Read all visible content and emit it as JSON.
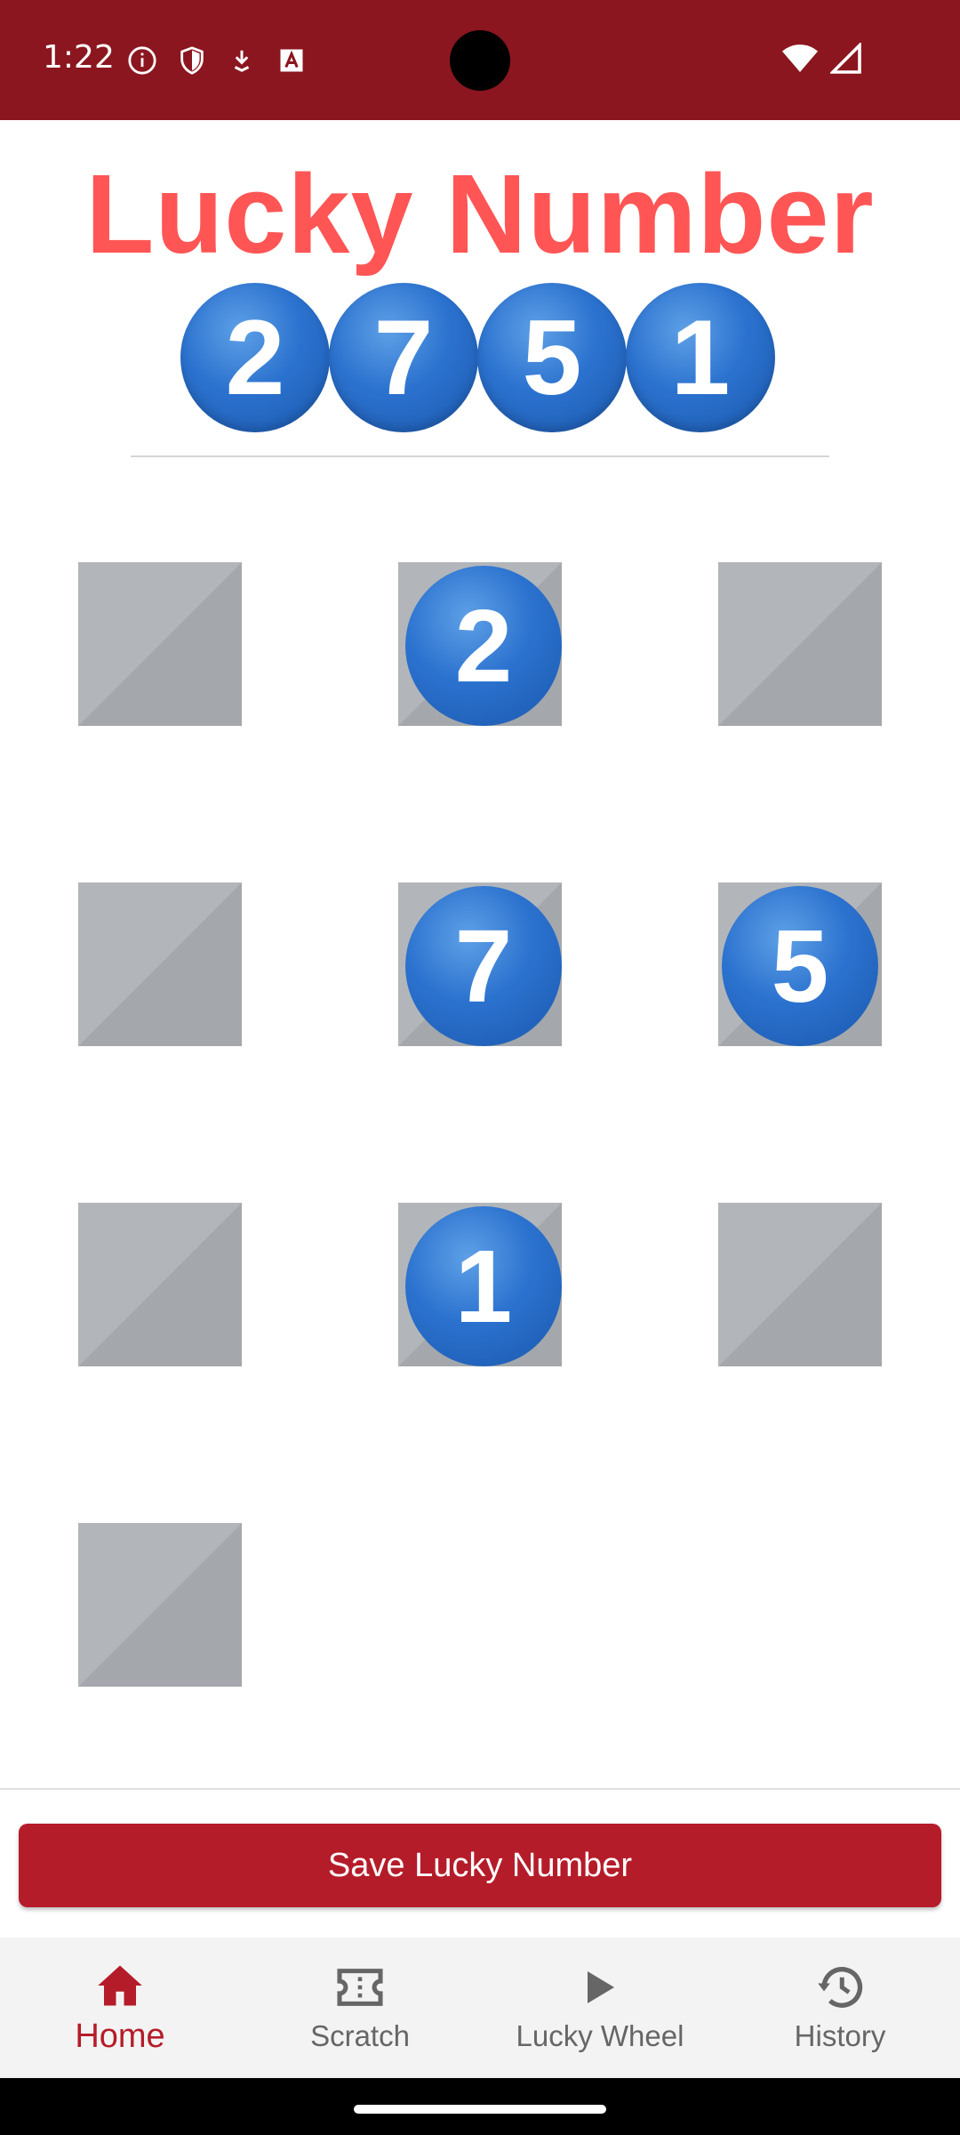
{
  "status_bar": {
    "time": "1:22",
    "icons": [
      "info-icon",
      "shield-icon",
      "download-icon",
      "text-icon"
    ],
    "right_icons": [
      "wifi-icon",
      "signal-icon"
    ],
    "color": "#8b161f"
  },
  "header": {
    "title": "Lucky Number",
    "title_color": "#ff5555",
    "numbers": [
      "2",
      "7",
      "5",
      "1"
    ]
  },
  "scratch_grid": {
    "tiles": [
      {
        "revealed": false,
        "value": ""
      },
      {
        "revealed": true,
        "value": "2"
      },
      {
        "revealed": false,
        "value": ""
      },
      {
        "revealed": false,
        "value": ""
      },
      {
        "revealed": true,
        "value": "7"
      },
      {
        "revealed": true,
        "value": "5"
      },
      {
        "revealed": false,
        "value": ""
      },
      {
        "revealed": true,
        "value": "1"
      },
      {
        "revealed": false,
        "value": ""
      },
      {
        "revealed": false,
        "value": ""
      }
    ]
  },
  "actions": {
    "save_label": "Save Lucky Number",
    "accent": "#b51c29"
  },
  "bottom_nav": {
    "items": [
      {
        "label": "Home",
        "icon": "home-icon",
        "active": true
      },
      {
        "label": "Scratch",
        "icon": "ticket-icon",
        "active": false
      },
      {
        "label": "Lucky Wheel",
        "icon": "play-icon",
        "active": false
      },
      {
        "label": "History",
        "icon": "history-icon",
        "active": false
      }
    ]
  }
}
